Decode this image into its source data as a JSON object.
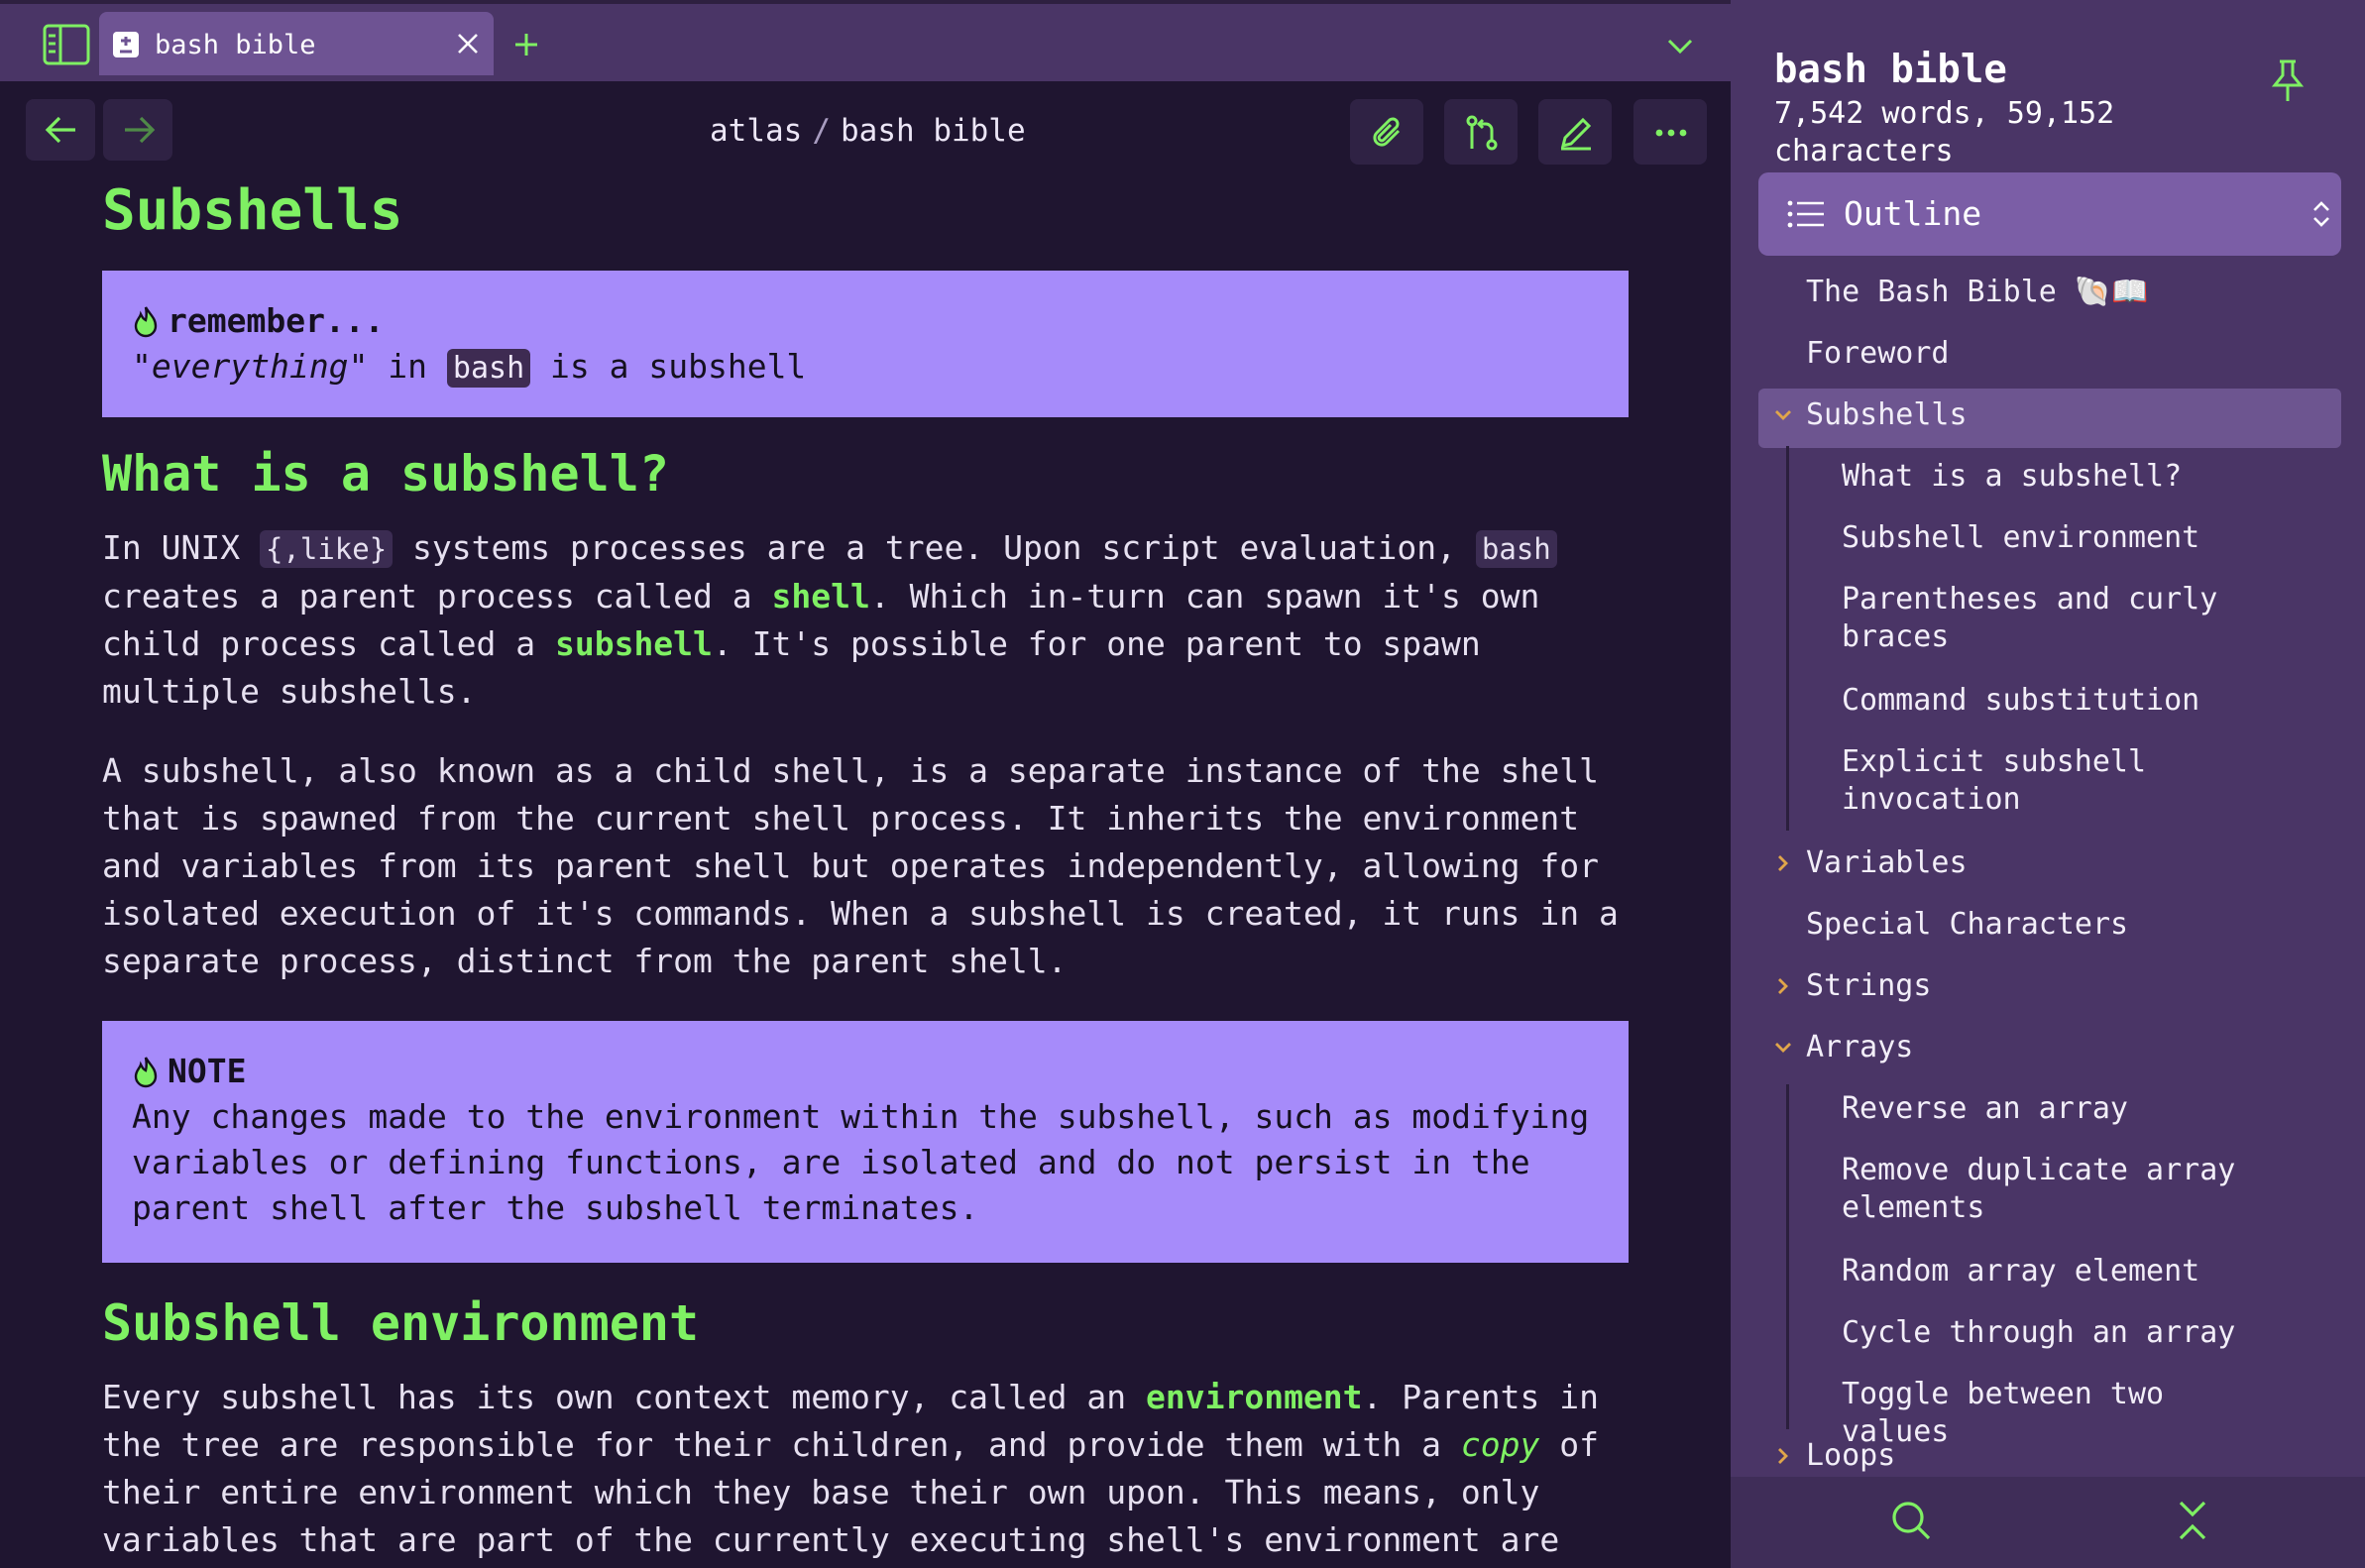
{
  "colors": {
    "accent": "#7ff063",
    "callout": "#a68bfa",
    "background": "#1f1530",
    "chrome": "#4a3566"
  },
  "tab": {
    "label": "bash bible",
    "icons": [
      "sidebar-toggle-icon",
      "document-icon",
      "close-icon",
      "plus-icon",
      "chevron-down-icon"
    ]
  },
  "toolbar": {
    "breadcrumb_root": "atlas",
    "breadcrumb_sep": "/",
    "breadcrumb_page": "bash bible",
    "icons": [
      "arrow-left-icon",
      "arrow-right-icon",
      "paperclip-icon",
      "git-branch-icon",
      "pencil-icon",
      "more-icon"
    ]
  },
  "doc": {
    "title": "Subshells",
    "callout1": {
      "title": "remember...",
      "q1": "\"",
      "em": "everything",
      "q2": "\" in ",
      "code": "bash",
      "rest": " is a subshell"
    },
    "h2_what": "What is a subshell?",
    "p1": {
      "a": "In UNIX ",
      "code1": "{,like}",
      "b": " systems processes are a tree. Upon script evaluation, ",
      "code2": "bash",
      "c": " creates a parent process called a ",
      "hl1": "shell",
      "d": ". Which in-turn can spawn it's own child process called a ",
      "hl2": "subshell",
      "e": ". It's possible for one parent to spawn multiple subshells."
    },
    "p2": "A subshell, also known as a child shell, is a separate instance of the shell that is spawned from the current shell process. It inherits the environment and variables from its parent shell but operates independently, allowing for isolated execution of it's commands. When a subshell is created, it runs in a separate process, distinct from the parent shell.",
    "note": {
      "title": "NOTE",
      "text": "Any changes made to the environment within the subshell, such as modifying variables or defining functions, are isolated and do not persist in the parent shell after the subshell terminates."
    },
    "h2_env": "Subshell environment",
    "p3": {
      "a": "Every subshell has its own context memory, called an ",
      "hl": "environment",
      "b": ". Parents in the tree are responsible for their children, and provide them with a ",
      "em": "copy",
      "c": " of their entire environment which they base their own upon. This means, only variables that are part of the currently executing shell's environment are available in"
    }
  },
  "sidebar": {
    "title": "bash bible",
    "stats": "7,542 words, 59,152 characters",
    "outline_label": "Outline",
    "items": [
      {
        "label": "The Bash Bible 🐚📖",
        "level": 0
      },
      {
        "label": "Foreword",
        "level": 0
      },
      {
        "label": "Subshells",
        "level": 0,
        "expanded": true,
        "active": true
      },
      {
        "label": "What is a subshell?",
        "level": 1
      },
      {
        "label": "Subshell environment",
        "level": 1
      },
      {
        "label": "Parentheses and curly braces",
        "level": 1
      },
      {
        "label": "Command substitution",
        "level": 1
      },
      {
        "label": "Explicit subshell invocation",
        "level": 1
      },
      {
        "label": "Variables",
        "level": 0,
        "expanded": false
      },
      {
        "label": "Special Characters",
        "level": 0
      },
      {
        "label": "Strings",
        "level": 0,
        "expanded": false
      },
      {
        "label": "Arrays",
        "level": 0,
        "expanded": true
      },
      {
        "label": "Reverse an array",
        "level": 1
      },
      {
        "label": "Remove duplicate array elements",
        "level": 1
      },
      {
        "label": "Random array element",
        "level": 1
      },
      {
        "label": "Cycle through an array",
        "level": 1
      },
      {
        "label": "Toggle between two values",
        "level": 1
      },
      {
        "label": "Loops",
        "level": 0,
        "expanded": false
      }
    ],
    "icons": [
      "pin-icon",
      "list-icon",
      "updown-icon",
      "search-icon",
      "collapse-icon"
    ]
  }
}
